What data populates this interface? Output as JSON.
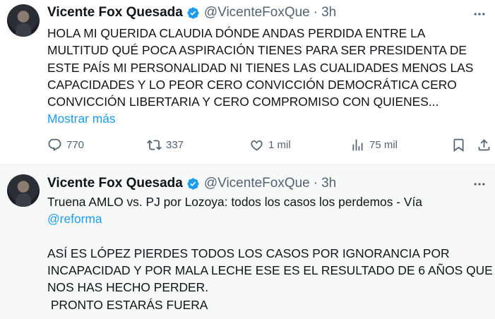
{
  "tweets": [
    {
      "author_name": "Vicente Fox Quesada",
      "handle": "@VicenteFoxQue",
      "separator": "·",
      "time": "3h",
      "text_lines": [
        "HOLA MI QUERIDA CLAUDIA DÓNDE ANDAS PERDIDA ENTRE LA",
        "MULTITUD QUÉ POCA ASPIRACIÓN TIENES PARA SER PRESIDENTA DE",
        "ESTE PAÍS MI PERSONALIDAD NI TIENES LAS CUALIDADES MENOS LAS",
        "CAPACIDADES Y LO PEOR CERO CONVICCIÓN DEMOCRÁTICA CERO",
        "CONVICCIÓN LIBERTARIA Y CERO COMPROMISO CON QUIENES..."
      ],
      "show_more": "Mostrar más",
      "stats": {
        "replies": "770",
        "retweets": "337",
        "likes": "1 mil",
        "views": "75 mil"
      }
    },
    {
      "author_name": "Vicente Fox Quesada",
      "handle": "@VicenteFoxQue",
      "separator": "·",
      "time": "3h",
      "text_line_1": "Truena AMLO vs. PJ por Lozoya: todos los casos los perdemos - Vía",
      "mention": "@reforma",
      "text_lines": [
        "ASÍ ES LÓPEZ PIERDES TODOS LOS CASOS POR IGNORANCIA POR",
        "INCAPACIDAD Y POR MALA LECHE ESE ES EL RESULTADO DE 6 AÑOS QUE",
        "NOS HAS HECHO PERDER.",
        " PRONTO ESTARÁS FUERA"
      ]
    }
  ],
  "colors": {
    "accent": "#1d9bf0",
    "text": "#0f1419",
    "muted": "#536471",
    "verified": "#1d9bf0"
  },
  "icons": [
    "more-icon",
    "verified-badge-icon",
    "reply-icon",
    "retweet-icon",
    "like-icon",
    "views-icon",
    "bookmark-icon",
    "share-icon"
  ]
}
